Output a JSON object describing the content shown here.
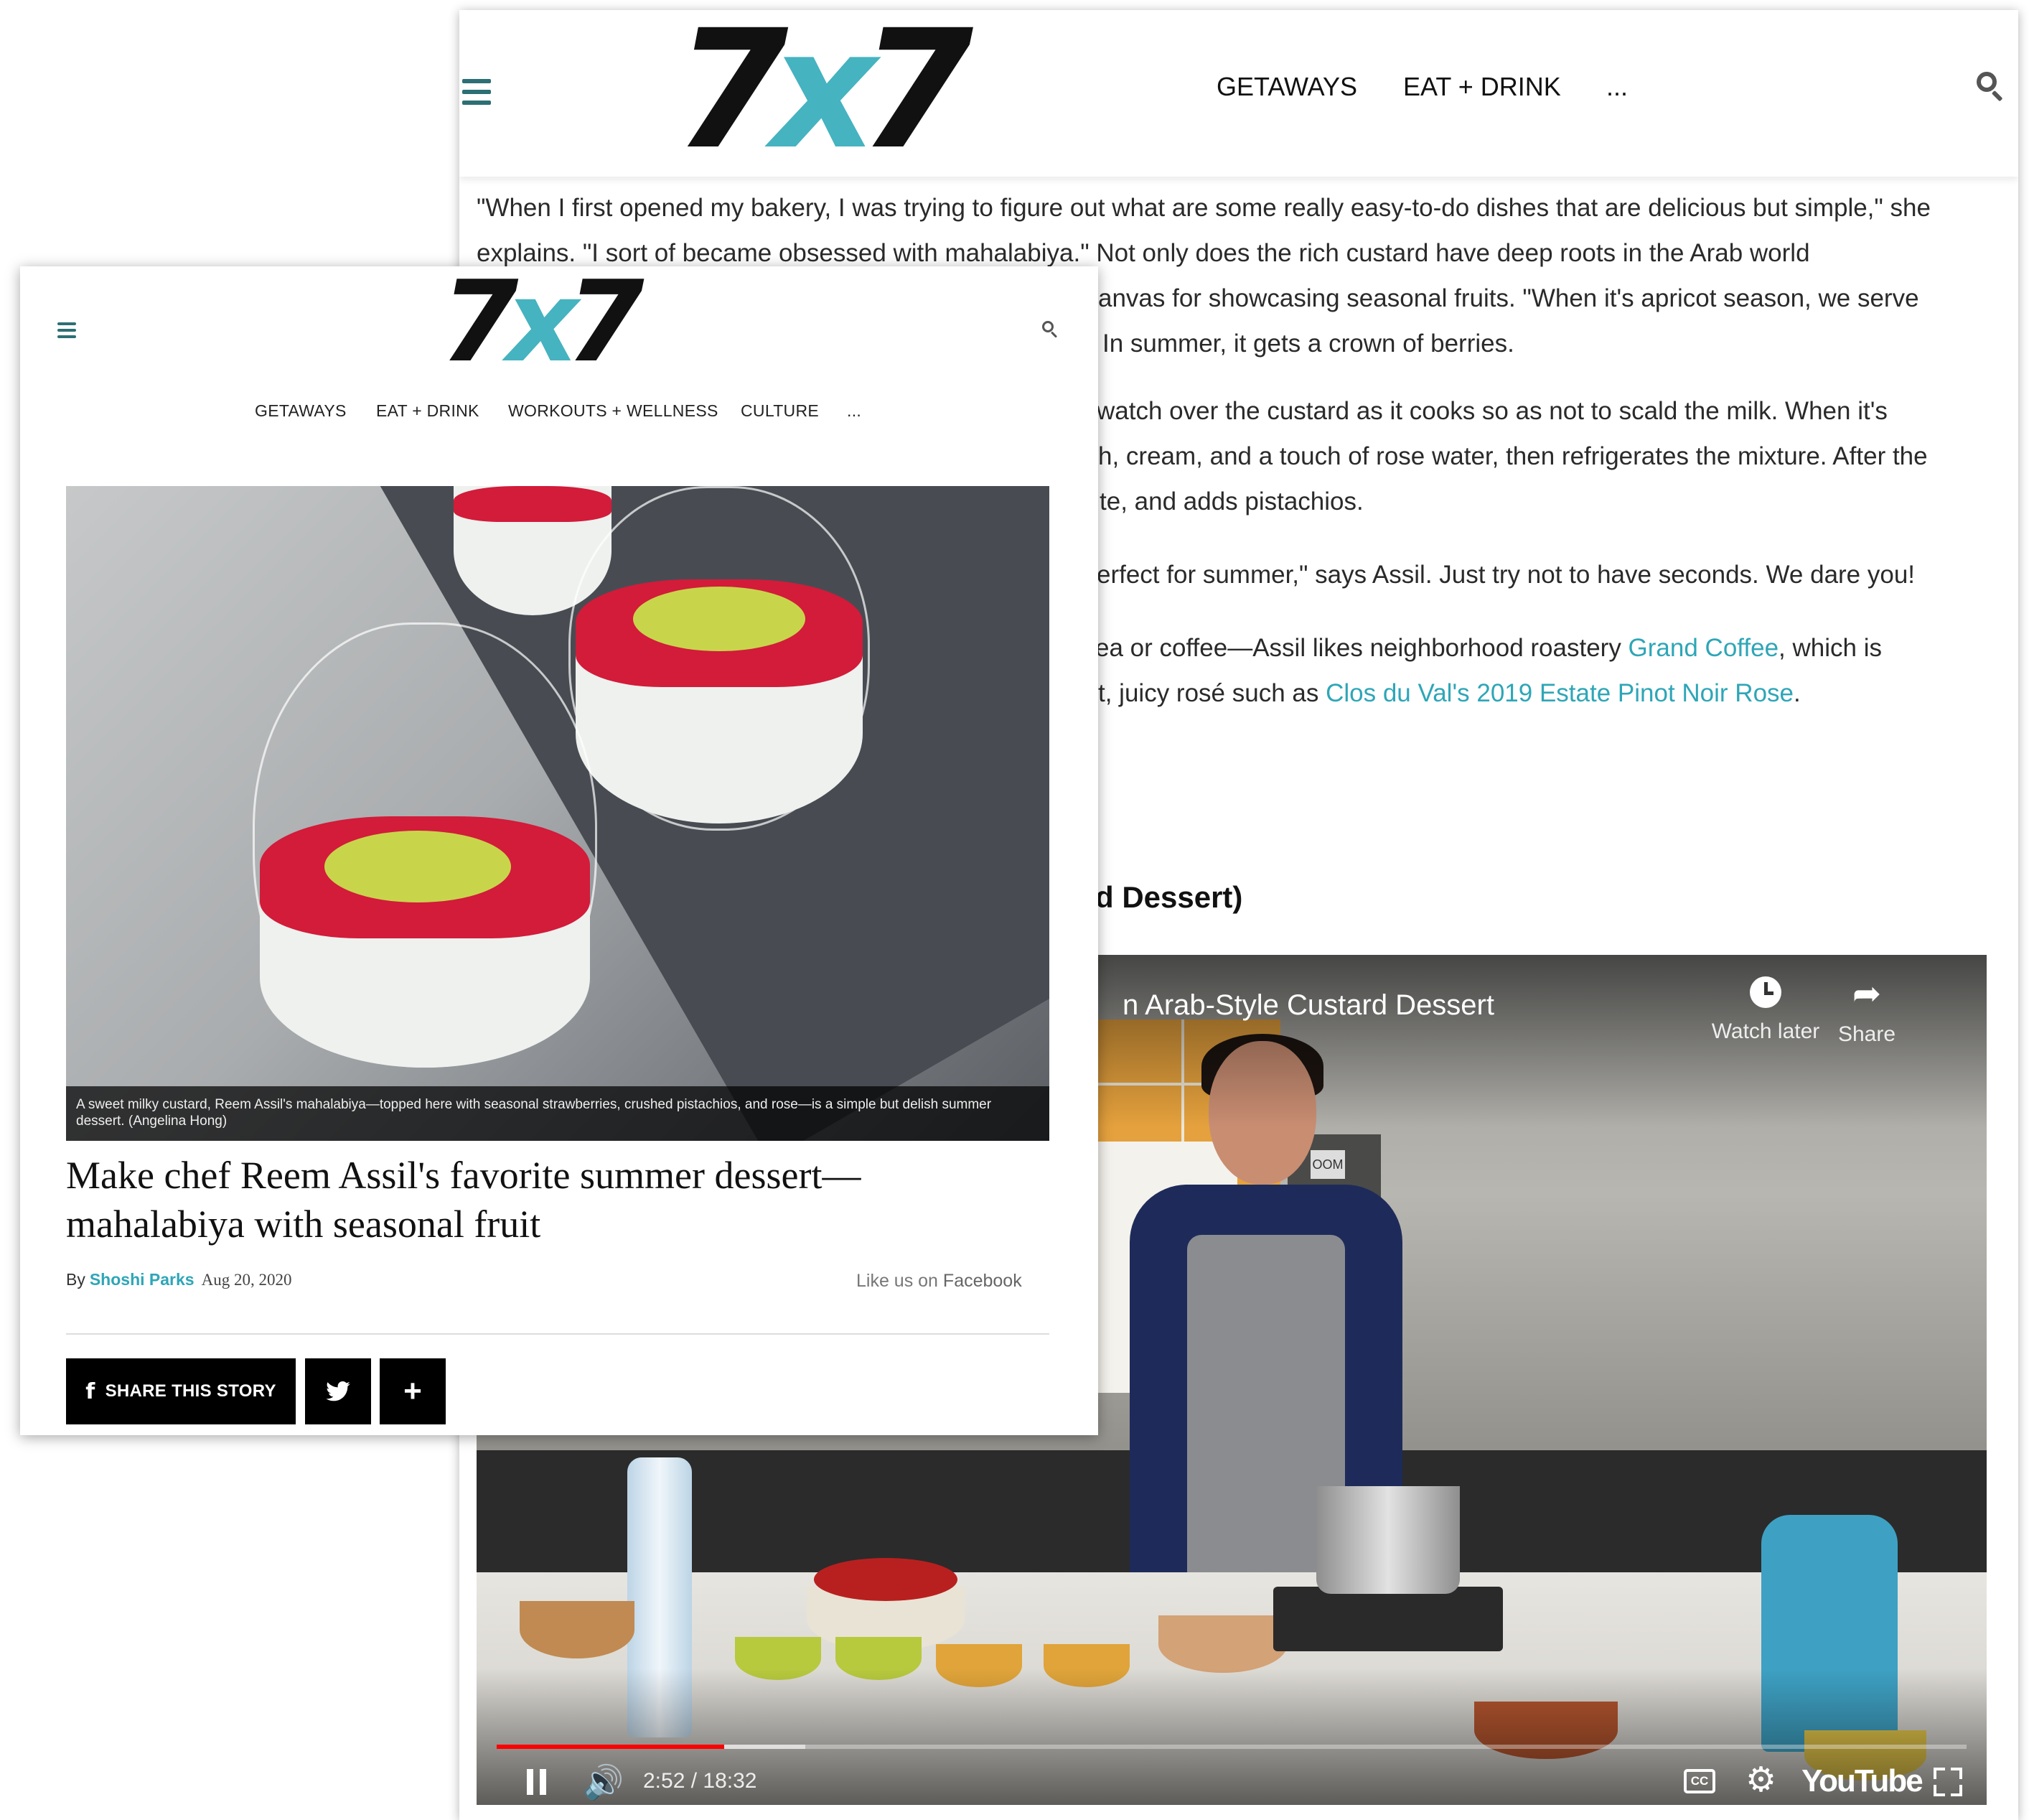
{
  "back_window": {
    "logo": {
      "digit_left": "7",
      "x": "x",
      "digit_right": "7"
    },
    "nav": [
      "GETAWAYS",
      "EAT + DRINK",
      "..."
    ],
    "article": {
      "p1": "\"When I first opened my bakery, I was trying to figure out what are some really easy-to-do dishes that are delicious but simple,\" she explains. \"I sort of became obsessed with mahalabiya.\" Not only does the rich custard have deep roots in the Arab world",
      "p1_line3": "anvas for showcasing seasonal fruits. \"When it's apricot season, we serve",
      "p1_line4": "In summer, it gets a crown of berries.",
      "p2_line1": "watch over the custard as it cooks so as not to scald the milk. When it's",
      "p2_line2": "h, cream, and a touch of rose water, then refrigerates the mixture. After the",
      "p2_line3": "te, and adds pistachios.",
      "p3": "erfect for summer,\" says Assil. Just try not to have seconds. We dare you!",
      "p4_line1_before": "ea or coffee—Assil likes neighborhood roastery ",
      "p4_link1": "Grand Coffee",
      "p4_line1_after": ", which is",
      "p4_line2_before": "t, juicy rosé such as ",
      "p4_link2": "Clos du Val's 2019 Estate Pinot Noir Rose",
      "p4_line2_after": ".",
      "heading_fragment": "d Dessert)"
    },
    "video": {
      "title": "n Arab-Style Custard Dessert",
      "watch_later": "Watch later",
      "share": "Share",
      "time": "2:52 / 18:32",
      "progress_fraction": 0.155,
      "buffered_fraction": 0.21,
      "youtube_label": "YouTube",
      "wall_sign": "OOM",
      "cc_label": "CC"
    }
  },
  "front_window": {
    "logo": {
      "digit_left": "7",
      "x": "x",
      "digit_right": "7"
    },
    "nav": [
      "GETAWAYS",
      "EAT + DRINK",
      "WORKOUTS + WELLNESS",
      "CULTURE",
      "..."
    ],
    "caption": "A sweet milky custard, Reem Assil's mahalabiya—topped here with seasonal strawberries, crushed pistachios, and rose—is a simple but delish summer dessert. (Angelina Hong)",
    "headline": "Make chef Reem Assil's favorite summer dessert—mahalabiya with seasonal fruit",
    "byline_prefix": "By",
    "author": "Shoshi Parks",
    "date": "Aug 20, 2020",
    "like_prefix": "Like us on ",
    "like_brand": "Facebook",
    "share_story": "SHARE THIS STORY"
  },
  "colors": {
    "accent": "#45b3c0",
    "link": "#2ea6b7",
    "progress": "#ff0000"
  },
  "icons": [
    "hamburger-icon",
    "search-icon",
    "clock-icon",
    "share-arrow-icon",
    "pause-icon",
    "volume-icon",
    "settings-icon",
    "fullscreen-icon",
    "facebook-icon",
    "twitter-icon",
    "plus-icon"
  ]
}
